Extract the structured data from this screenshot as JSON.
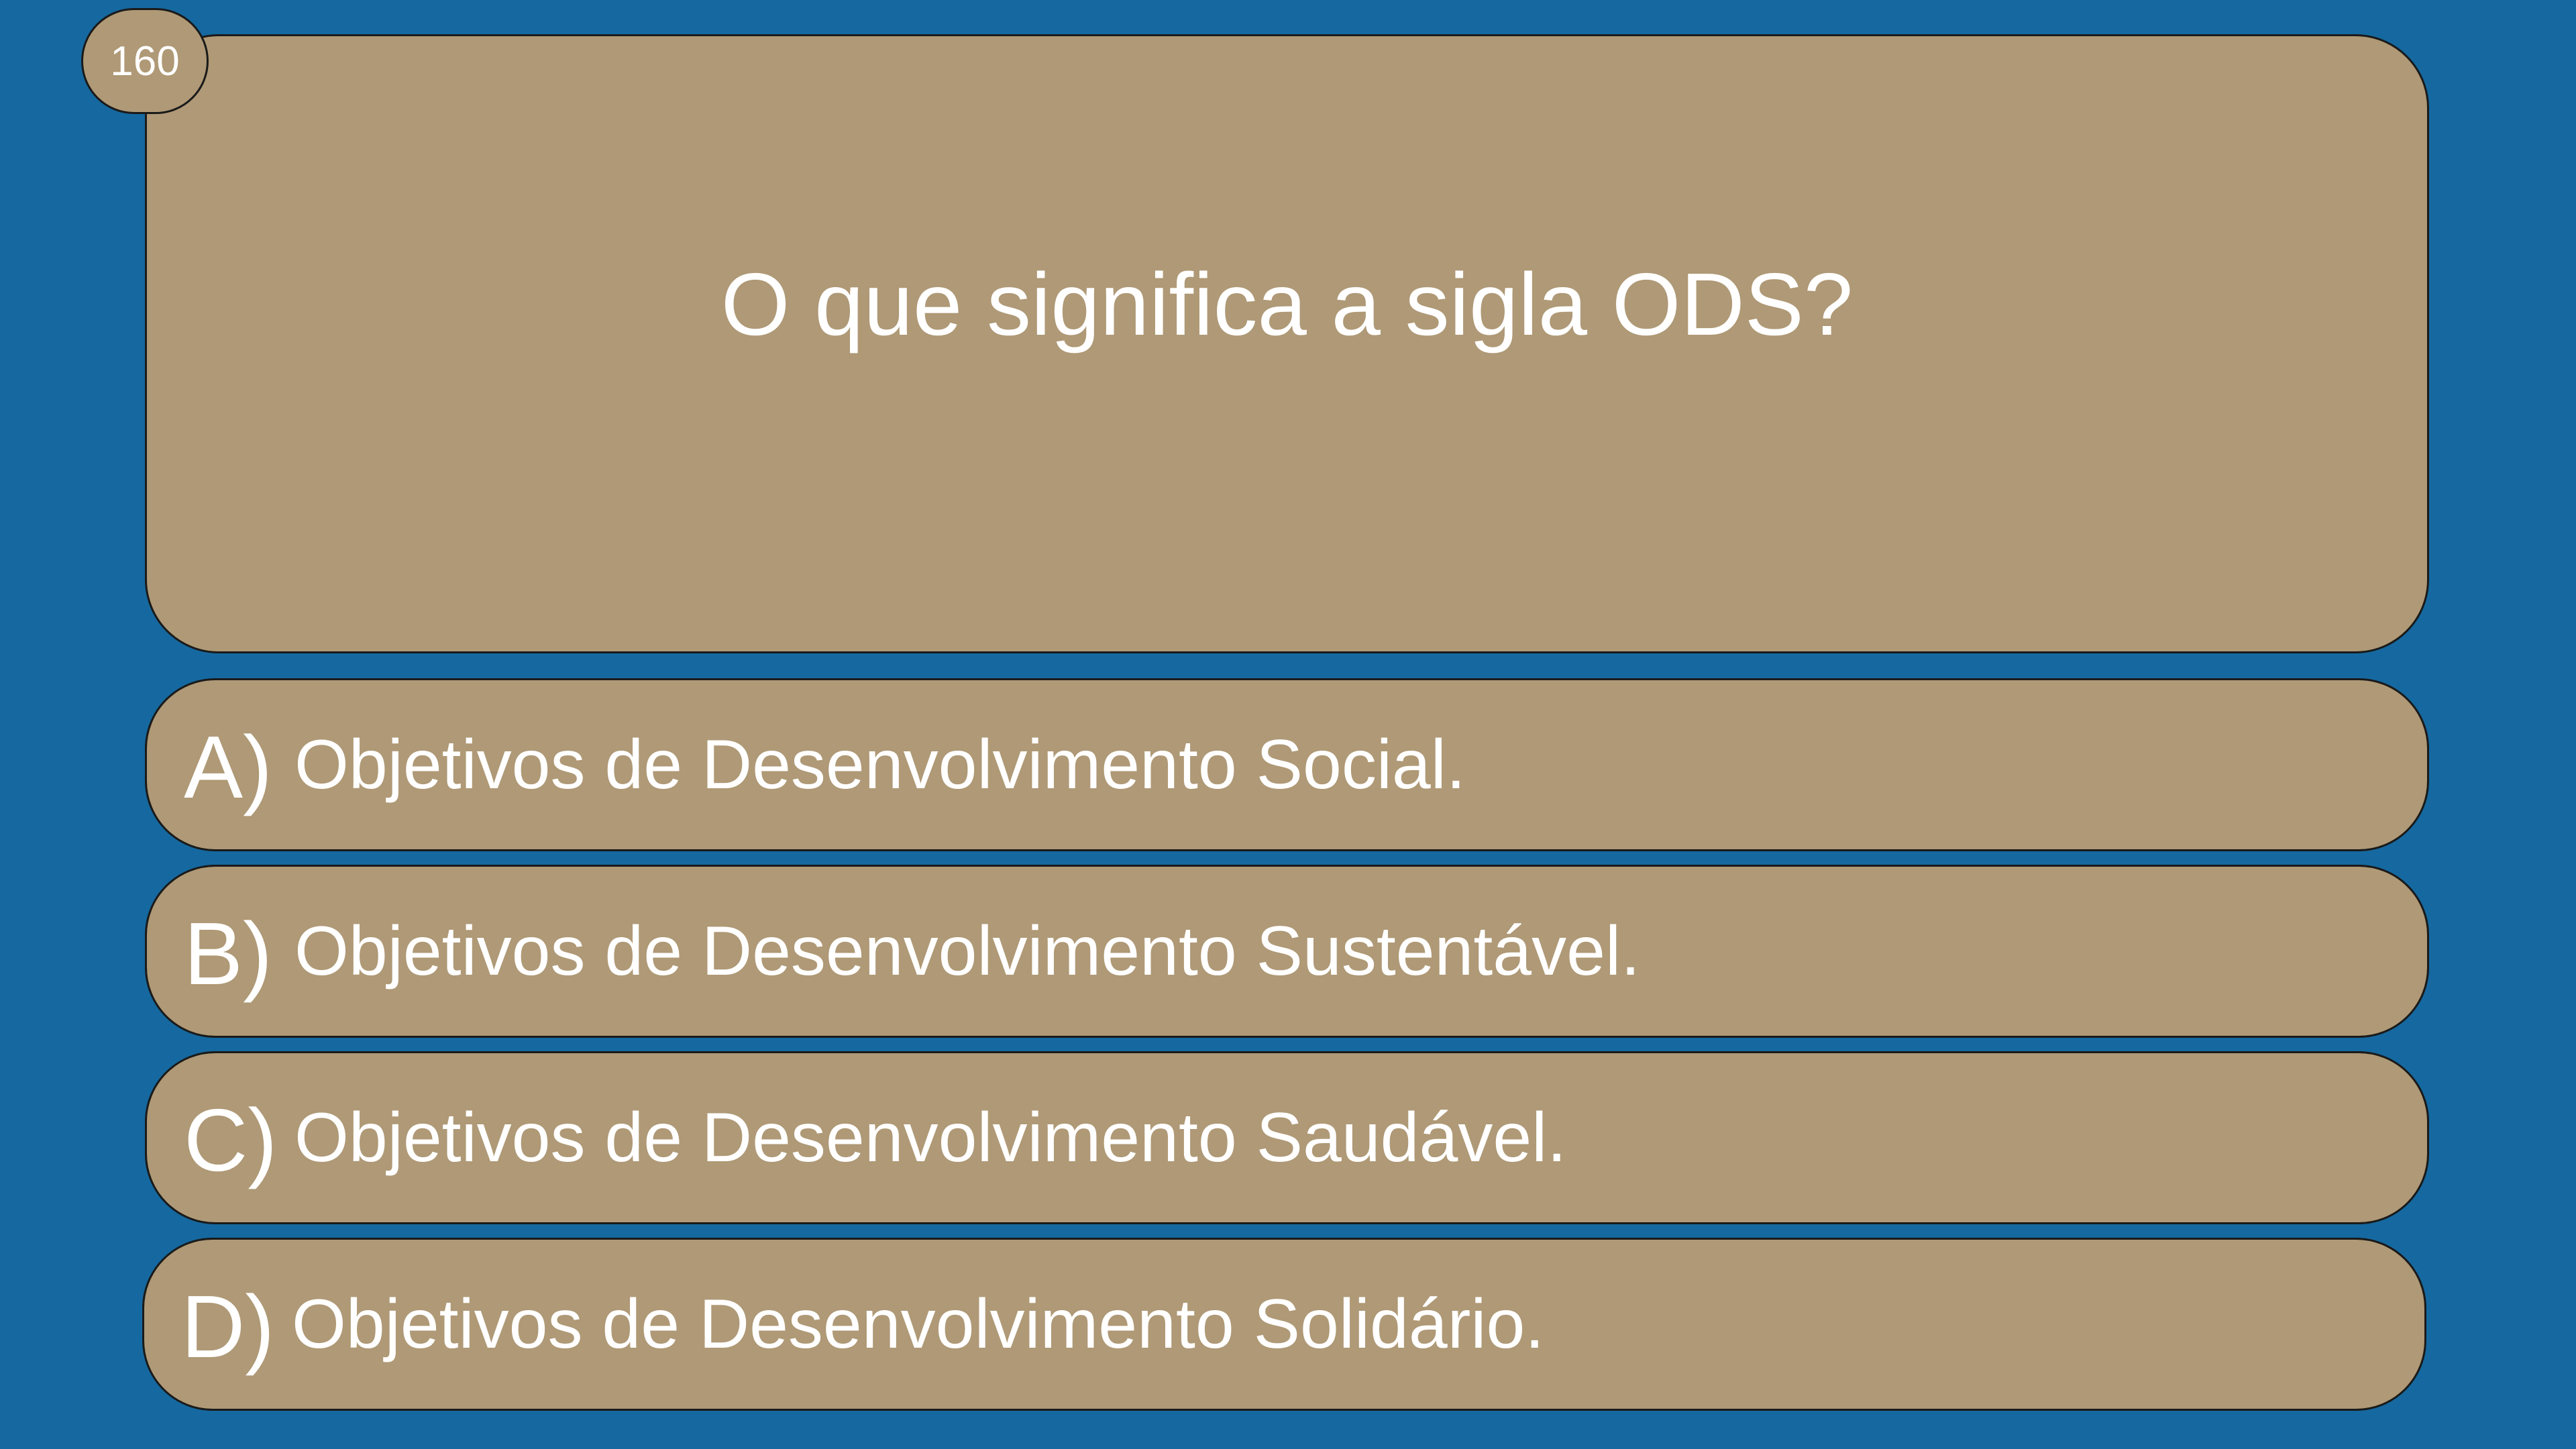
{
  "question": {
    "number": "160",
    "text": "O que significa a sigla ODS?"
  },
  "answers": [
    {
      "letter": "A)",
      "text": "Objetivos de Desenvolvimento Social."
    },
    {
      "letter": "B)",
      "text": "Objetivos de Desenvolvimento Sustentável."
    },
    {
      "letter": "C)",
      "text": "Objetivos de Desenvolvimento Saudável."
    },
    {
      "letter": "D)",
      "text": "Objetivos de Desenvolvimento Solidário."
    }
  ],
  "colors": {
    "background": "#1569a0",
    "panel": "#af9976",
    "border": "#1a1a1a",
    "text": "#ffffff"
  }
}
